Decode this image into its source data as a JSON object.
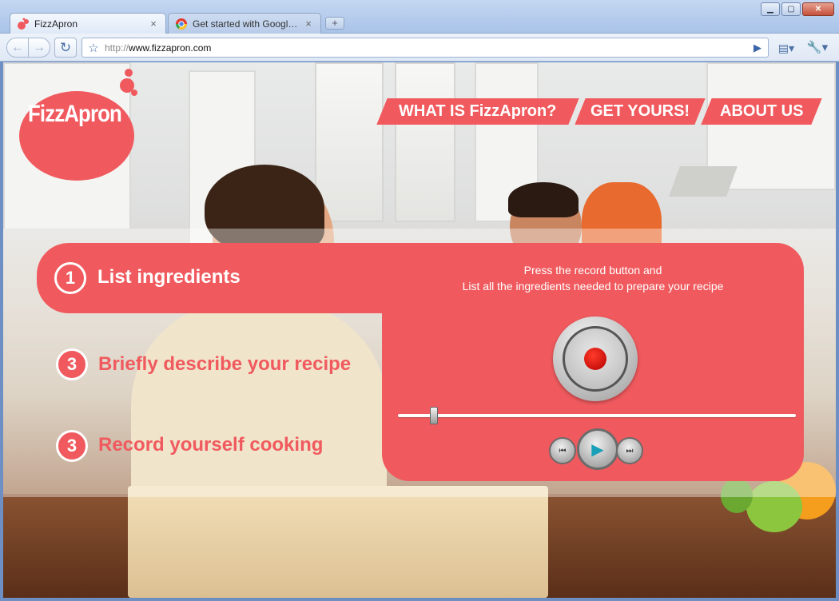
{
  "browser": {
    "tabs": [
      {
        "label": "FizzApron",
        "active": true
      },
      {
        "label": "Get started with Google ...",
        "active": false
      }
    ],
    "new_tab": "+",
    "url_scheme": "http://",
    "url_host": "www.fizzapron.com",
    "window_buttons": {
      "minimize": "▁",
      "maximize": "▢",
      "close": "✕"
    },
    "tab_close": "×",
    "icons": {
      "back": "←",
      "forward": "→",
      "reload": "↻",
      "star": "☆",
      "go": "▶",
      "page": "▤▾",
      "wrench": "🔧▾"
    }
  },
  "site": {
    "logo": "FizzApron",
    "nav": [
      "WHAT IS FizzApron?",
      "GET YOURS!",
      "ABOUT US"
    ],
    "steps": [
      {
        "number": "1",
        "label": "List ingredients",
        "active": true
      },
      {
        "number": "3",
        "label": "Briefly describe your recipe",
        "active": false
      },
      {
        "number": "3",
        "label": "Record yourself cooking",
        "active": false
      }
    ],
    "instructions": [
      "Press the record button and",
      "List all the ingredients needed to prepare your recipe"
    ],
    "player": {
      "progress": 0.09,
      "prev": "⏮",
      "play": "▶",
      "next": "⏭"
    }
  },
  "colors": {
    "brand": "#f05a5e",
    "record": "#d40000",
    "play_icon": "#1aa0b8"
  }
}
